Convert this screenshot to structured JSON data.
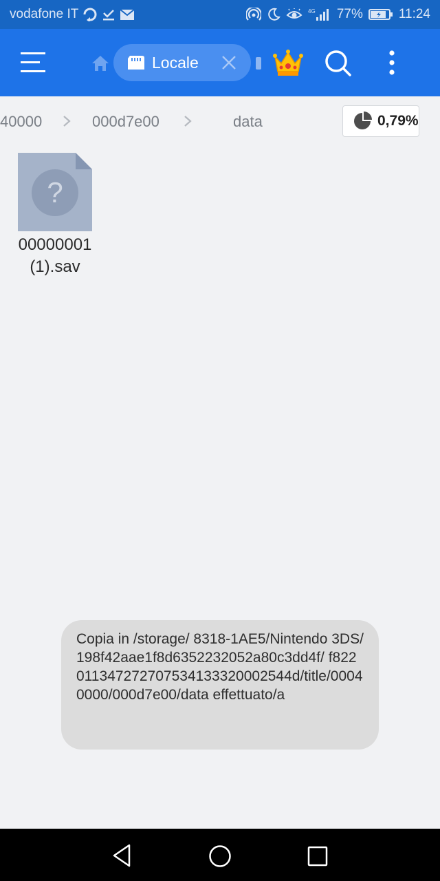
{
  "status_bar": {
    "carrier": "vodafone IT",
    "network": "4G",
    "battery": "77%",
    "time": "11:24"
  },
  "app_bar": {
    "tab_label": "Locale",
    "usage_percent": "0,79%"
  },
  "breadcrumb": {
    "items": [
      "40000",
      "000d7e00",
      "data"
    ]
  },
  "files": [
    {
      "name_line1": "00000001",
      "name_line2": "(1).sav",
      "icon": "unknown-file-icon"
    }
  ],
  "toast": {
    "message": "Copia in /storage/ 8318-1AE5/Nintendo 3DS/ 198f42aae1f8d6352232052a80c3dd4f/ f822011347272707534133320002544d/title/00040000/000d7e00/data effettuato/a"
  },
  "colors": {
    "status_bar": "#1766c3",
    "app_bar": "#1e73e8",
    "tab_pill": "#4a8ff0",
    "background": "#f1f2f4",
    "toast": "#dcdcdc",
    "file_icon": "#a5b3c9"
  }
}
